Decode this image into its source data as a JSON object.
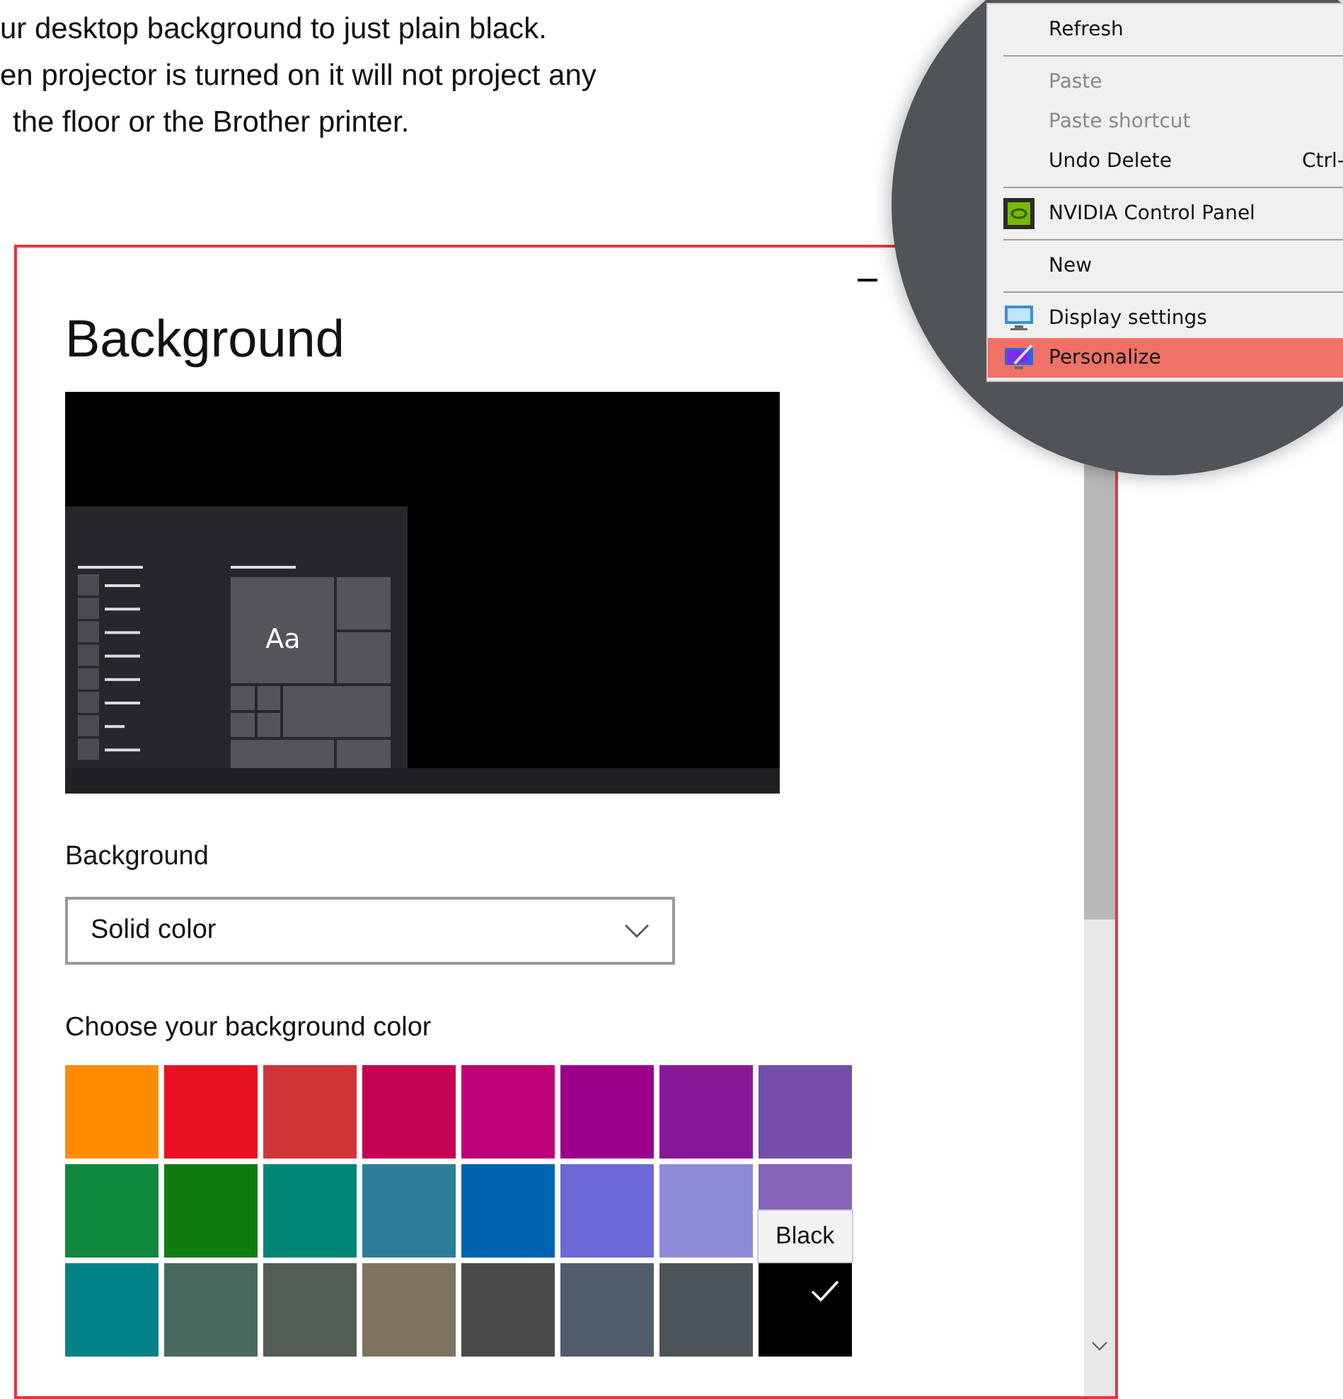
{
  "article_text": [
    "ur desktop background to just plain black.",
    "en projector is turned on it will not project any",
    "the floor or the Brother printer."
  ],
  "settings_window": {
    "title": "Background",
    "preview": {
      "tile_text": "Aa"
    },
    "background_label": "Background",
    "background_dropdown": {
      "value": "Solid color"
    },
    "color_label": "Choose your background color",
    "swatches": [
      {
        "color": "#ff8c00",
        "selected": false
      },
      {
        "color": "#e81123",
        "selected": false
      },
      {
        "color": "#d13438",
        "selected": false
      },
      {
        "color": "#c30052",
        "selected": false
      },
      {
        "color": "#bf0077",
        "selected": false
      },
      {
        "color": "#9a0089",
        "selected": false
      },
      {
        "color": "#881798",
        "selected": false
      },
      {
        "color": "#744da9",
        "selected": false
      },
      {
        "color": "#10893e",
        "selected": false
      },
      {
        "color": "#107c10",
        "selected": false
      },
      {
        "color": "#018574",
        "selected": false
      },
      {
        "color": "#2d7d9a",
        "selected": false
      },
      {
        "color": "#0063b1",
        "selected": false
      },
      {
        "color": "#6b69d6",
        "selected": false
      },
      {
        "color": "#8e8cd8",
        "selected": false
      },
      {
        "color": "#8764b8",
        "selected": false
      },
      {
        "color": "#038387",
        "selected": false
      },
      {
        "color": "#486860",
        "selected": false
      },
      {
        "color": "#525e54",
        "selected": false
      },
      {
        "color": "#7e735f",
        "selected": false
      },
      {
        "color": "#4c4a48",
        "selected": false
      },
      {
        "color": "#515c6b",
        "selected": false
      },
      {
        "color": "#4a5459",
        "selected": false
      },
      {
        "color": "#000000",
        "selected": true
      }
    ],
    "tooltip": "Black"
  },
  "context_menu": {
    "items": [
      {
        "kind": "text",
        "label": "Refresh",
        "disabled": false,
        "highlighted": false
      },
      {
        "kind": "separator"
      },
      {
        "kind": "text",
        "label": "Paste",
        "disabled": true,
        "highlighted": false
      },
      {
        "kind": "text",
        "label": "Paste shortcut",
        "disabled": true,
        "highlighted": false
      },
      {
        "kind": "text",
        "label": "Undo Delete",
        "shortcut": "Ctrl-",
        "disabled": false,
        "highlighted": false
      },
      {
        "kind": "separator"
      },
      {
        "kind": "chip",
        "label": "NVIDIA Control Panel",
        "disabled": false,
        "highlighted": false
      },
      {
        "kind": "separator"
      },
      {
        "kind": "text",
        "label": "New",
        "disabled": false,
        "highlighted": false
      },
      {
        "kind": "separator"
      },
      {
        "kind": "monitor",
        "label": "Display settings",
        "disabled": false,
        "highlighted": false
      },
      {
        "kind": "brush",
        "label": "Personalize",
        "disabled": false,
        "highlighted": true
      }
    ]
  }
}
